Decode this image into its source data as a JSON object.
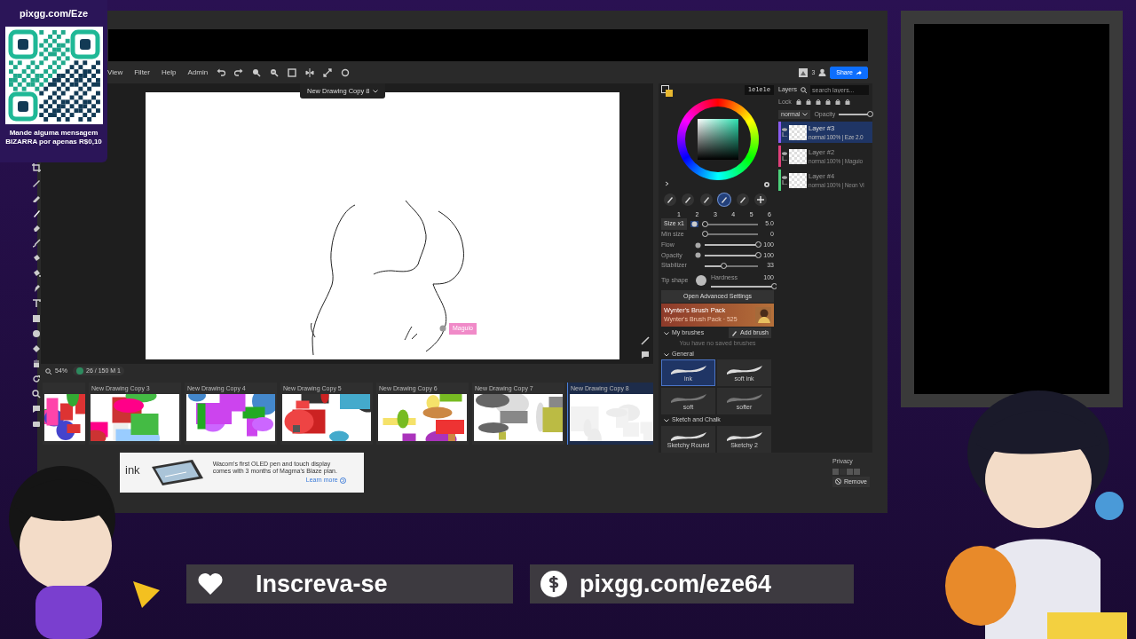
{
  "donation_card": {
    "site": "pixgg.com/Eze",
    "message": "Mande alguma mensagem BIZARRA por apenas R$0,10"
  },
  "menu": [
    "View",
    "Filter",
    "Help",
    "Admin"
  ],
  "document_title": "New Drawing Copy 8",
  "header_right": {
    "count": "3",
    "share": "Share"
  },
  "cursor_label": "Maguio",
  "status": {
    "zoom": "54%",
    "pages": "26 / 150",
    "mode": "M 1"
  },
  "drawings": [
    {
      "selected": false
    },
    {
      "title": "New Drawing Copy 3",
      "selected": false
    },
    {
      "title": "New Drawing Copy 4",
      "selected": false
    },
    {
      "title": "New Drawing Copy 5",
      "selected": false
    },
    {
      "title": "New Drawing Copy 6",
      "selected": false
    },
    {
      "title": "New Drawing Copy 7",
      "selected": false
    },
    {
      "title": "New Drawing Copy 8",
      "selected": true
    }
  ],
  "color_hex": "1e1e1e",
  "brush_slots": [
    {
      "kind": "brush",
      "label": "1",
      "selected": false
    },
    {
      "kind": "brush",
      "label": "2",
      "selected": false
    },
    {
      "kind": "brush",
      "label": "3",
      "selected": false
    },
    {
      "kind": "brush",
      "label": "4",
      "selected": true
    },
    {
      "kind": "brush",
      "label": "5",
      "selected": false
    },
    {
      "kind": "add",
      "label": "6",
      "selected": false
    }
  ],
  "sliders": [
    {
      "kind": "button",
      "label": "Size x1",
      "reading": "5.0",
      "level": 0.05
    },
    {
      "kind": "plain",
      "label": "Min size",
      "reading": "0",
      "level": 0
    },
    {
      "kind": "pressure",
      "label": "Flow",
      "reading": "100",
      "level": 1
    },
    {
      "kind": "pressure",
      "label": "Opacity",
      "reading": "100",
      "level": 1
    },
    {
      "kind": "plain",
      "label": "Stabilizer",
      "reading": "33",
      "level": 0.35
    }
  ],
  "tip": {
    "label": "Tip shape",
    "hardness_label": "Hardness",
    "hardness": "100",
    "level": 1
  },
  "advanced_button": "Open Advanced Settings",
  "brush_pack": {
    "title": "Wynter's Brush Pack",
    "subtitle": "Wynter's Brush Pack · 525"
  },
  "my_brushes": {
    "title": "My brushes",
    "add": "Add brush",
    "empty": "You have no saved brushes"
  },
  "brush_groups": [
    {
      "title": "General",
      "brushes": [
        {
          "name": "ink",
          "selected": true
        },
        {
          "name": "soft ink",
          "selected": false
        },
        {
          "name": "soft",
          "selected": false
        },
        {
          "name": "softer",
          "selected": false
        }
      ]
    },
    {
      "title": "Sketch and Chalk",
      "brushes": [
        {
          "name": "Sketchy Round",
          "selected": false
        },
        {
          "name": "Sketchy 2",
          "selected": false
        }
      ]
    }
  ],
  "layers": {
    "title": "Layers",
    "search_placeholder": "search layers...",
    "lock": "Lock",
    "blend": "normal",
    "opacity": {
      "label": "Opacity",
      "level": 1
    },
    "items": [
      {
        "name": "Layer #3",
        "info": "normal 100% | Eze 2.0",
        "selected": true,
        "color": "#8a5cf0"
      },
      {
        "name": "Layer #2",
        "info": "normal 100% | Maguio",
        "selected": false,
        "color": "#e0407a"
      },
      {
        "name": "Layer #4",
        "info": "normal 100% | Neon Vi",
        "selected": false,
        "color": "#4cd07a"
      }
    ]
  },
  "ad": {
    "partial": "ink",
    "text": "Wacom's first OLED pen and touch display comes with 3 months of Magma's Blaze plan.",
    "link": "Learn more"
  },
  "privacy": {
    "label": "Privacy",
    "remove": "Remove"
  },
  "banners": [
    {
      "kind": "heart",
      "text": "Inscreva-se"
    },
    {
      "kind": "dollar",
      "text": "pixgg.com/eze64"
    }
  ]
}
